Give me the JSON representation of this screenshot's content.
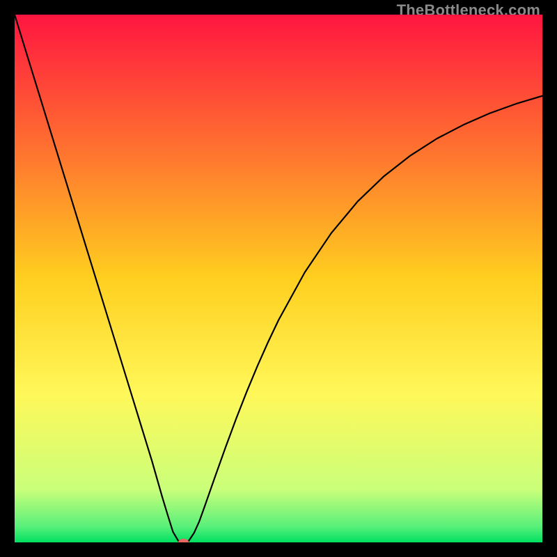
{
  "watermark": {
    "text": "TheBottleneck.com"
  },
  "chart_data": {
    "type": "line",
    "title": "",
    "xlabel": "",
    "ylabel": "",
    "xlim": [
      0,
      100
    ],
    "ylim": [
      0,
      100
    ],
    "grid": false,
    "legend": false,
    "background_gradient": {
      "stops": [
        {
          "pos": 0.0,
          "color": "#ff1540"
        },
        {
          "pos": 0.25,
          "color": "#ff7030"
        },
        {
          "pos": 0.5,
          "color": "#ffcf1f"
        },
        {
          "pos": 0.72,
          "color": "#fff85a"
        },
        {
          "pos": 0.9,
          "color": "#caff7a"
        },
        {
          "pos": 0.97,
          "color": "#58f07a"
        },
        {
          "pos": 1.0,
          "color": "#00e060"
        }
      ]
    },
    "series": [
      {
        "name": "bottleneck-curve",
        "color": "#000000",
        "x": [
          0,
          2,
          4,
          6,
          8,
          10,
          12,
          14,
          16,
          18,
          20,
          22,
          24,
          26,
          28,
          29,
          30,
          31,
          32,
          33,
          34,
          35,
          36,
          38,
          40,
          42,
          44,
          46,
          48,
          50,
          55,
          60,
          65,
          70,
          75,
          80,
          85,
          90,
          95,
          100
        ],
        "y": [
          100,
          93.5,
          87.0,
          80.5,
          74.0,
          67.5,
          61.0,
          54.5,
          48.0,
          41.5,
          35.0,
          28.5,
          22.0,
          15.5,
          8.5,
          5.2,
          2.0,
          0.3,
          0.0,
          0.3,
          1.8,
          4.0,
          6.8,
          12.5,
          18.1,
          23.5,
          28.6,
          33.4,
          37.9,
          42.1,
          51.2,
          58.6,
          64.6,
          69.4,
          73.3,
          76.5,
          79.1,
          81.3,
          83.1,
          84.6
        ]
      }
    ],
    "marker": {
      "name": "optimum-point",
      "x": 32,
      "y": 0,
      "rx_frac": 0.01,
      "ry_frac": 0.007,
      "color": "#e46a62"
    }
  }
}
